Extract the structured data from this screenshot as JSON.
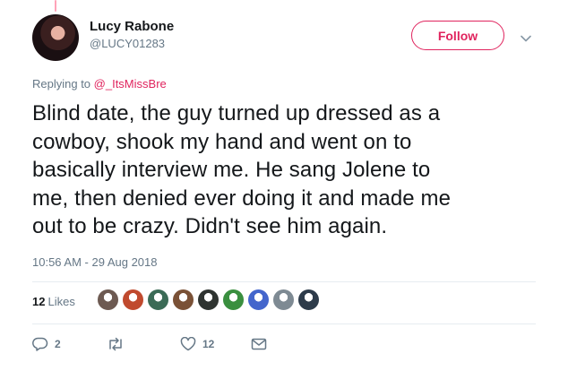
{
  "tweet": {
    "display_name": "Lucy Rabone",
    "handle": "@LUCY01283",
    "follow_label": "Follow",
    "reply_prefix": "Replying to ",
    "reply_mention": "@_ItsMissBre",
    "text_lines": [
      "Blind date, the guy turned up dressed as a",
      "cowboy, shook my hand and went on to",
      "basically interview me. He sang Jolene to",
      "me, then denied ever doing it and made me",
      "out to be crazy. Didn't see him again."
    ],
    "timestamp": "10:56 AM - 29 Aug 2018",
    "likes_count": "12",
    "likes_label": "Likes",
    "liker_colors": [
      "#6d5a52",
      "#c04a2e",
      "#3b6b56",
      "#7a5136",
      "#2f3431",
      "#3a8f3f",
      "#4466cc",
      "#7e8a93",
      "#2d3b4a"
    ],
    "actions": {
      "reply_count": "2",
      "retweet_count": "",
      "like_count": "12"
    },
    "colors": {
      "accent": "#e0245e",
      "muted": "#657786",
      "text": "#14171a"
    }
  }
}
